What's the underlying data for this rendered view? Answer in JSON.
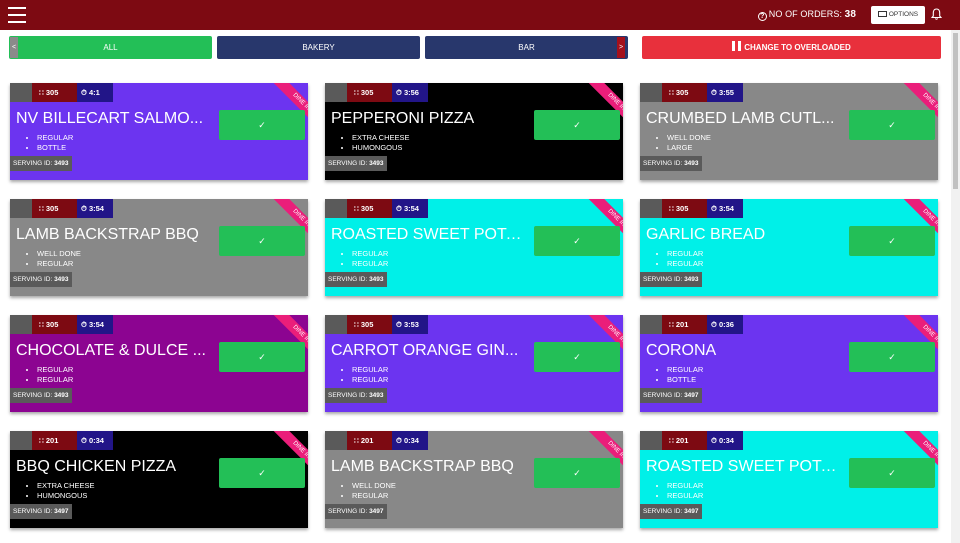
{
  "header": {
    "orders_label": "NO OF ORDERS: ",
    "orders_count": "38",
    "options_label": "OPTIONS",
    "bg": "#7d0a12"
  },
  "filters": {
    "left_arrow": "<",
    "right_arrow": ">",
    "all": "ALL",
    "bakery": "BAKERY",
    "bar": "BAR",
    "overloaded": "CHANGE TO OVERLOADED"
  },
  "colors": {
    "purple": "#6c34f0",
    "black": "#000000",
    "gray": "#888888",
    "cyan": "#00f0e8",
    "magenta": "#8c0491",
    "done_green": "#23bf57",
    "ribbon_pink": "#ea1e7a",
    "filter_green": "#23bf57",
    "filter_navy": "#28376c",
    "filter_red": "#e8303c"
  },
  "card_labels": {
    "dine_in": "DINE IN",
    "serving_prefix": "SERVING ID: ",
    "done_icon": "✓"
  },
  "orders": [
    {
      "table": "305",
      "time": "4:1",
      "name": "NV BILLECART SALMO...",
      "mods": [
        "REGULAR",
        "BOTTLE"
      ],
      "serving_id": "3493",
      "color": "#6c34f0"
    },
    {
      "table": "305",
      "time": "3:56",
      "name": "PEPPERONI PIZZA",
      "mods": [
        "EXTRA CHEESE",
        "HUMONGOUS"
      ],
      "serving_id": "3493",
      "color": "#000000"
    },
    {
      "table": "305",
      "time": "3:55",
      "name": "CRUMBED LAMB CUTL...",
      "mods": [
        "WELL DONE",
        "LARGE"
      ],
      "serving_id": "3493",
      "color": "#888888"
    },
    {
      "table": "305",
      "time": "3:54",
      "name": "LAMB BACKSTRAP BBQ",
      "mods": [
        "WELL DONE",
        "REGULAR"
      ],
      "serving_id": "3493",
      "color": "#888888"
    },
    {
      "table": "305",
      "time": "3:54",
      "name": "ROASTED SWEET POTA...",
      "mods": [
        "REGULAR",
        "REGULAR"
      ],
      "serving_id": "3493",
      "color": "#00f0e8"
    },
    {
      "table": "305",
      "time": "3:54",
      "name": "GARLIC BREAD",
      "mods": [
        "REGULAR",
        "REGULAR"
      ],
      "serving_id": "3493",
      "color": "#00f0e8"
    },
    {
      "table": "305",
      "time": "3:54",
      "name": "CHOCOLATE & DULCE ...",
      "mods": [
        "REGULAR",
        "REGULAR"
      ],
      "serving_id": "3493",
      "color": "#8c0491"
    },
    {
      "table": "305",
      "time": "3:53",
      "name": "CARROT ORANGE GIN...",
      "mods": [
        "REGULAR",
        "REGULAR"
      ],
      "serving_id": "3493",
      "color": "#6c34f0"
    },
    {
      "table": "201",
      "time": "0:36",
      "name": "CORONA",
      "mods": [
        "REGULAR",
        "BOTTLE"
      ],
      "serving_id": "3497",
      "color": "#6c34f0"
    },
    {
      "table": "201",
      "time": "0:34",
      "name": "BBQ CHICKEN PIZZA",
      "mods": [
        "EXTRA CHEESE",
        "HUMONGOUS"
      ],
      "serving_id": "3497",
      "color": "#000000"
    },
    {
      "table": "201",
      "time": "0:34",
      "name": "LAMB BACKSTRAP BBQ",
      "mods": [
        "WELL DONE",
        "REGULAR"
      ],
      "serving_id": "3497",
      "color": "#888888"
    },
    {
      "table": "201",
      "time": "0:34",
      "name": "ROASTED SWEET POTA...",
      "mods": [
        "REGULAR",
        "REGULAR"
      ],
      "serving_id": "3497",
      "color": "#00f0e8"
    }
  ]
}
